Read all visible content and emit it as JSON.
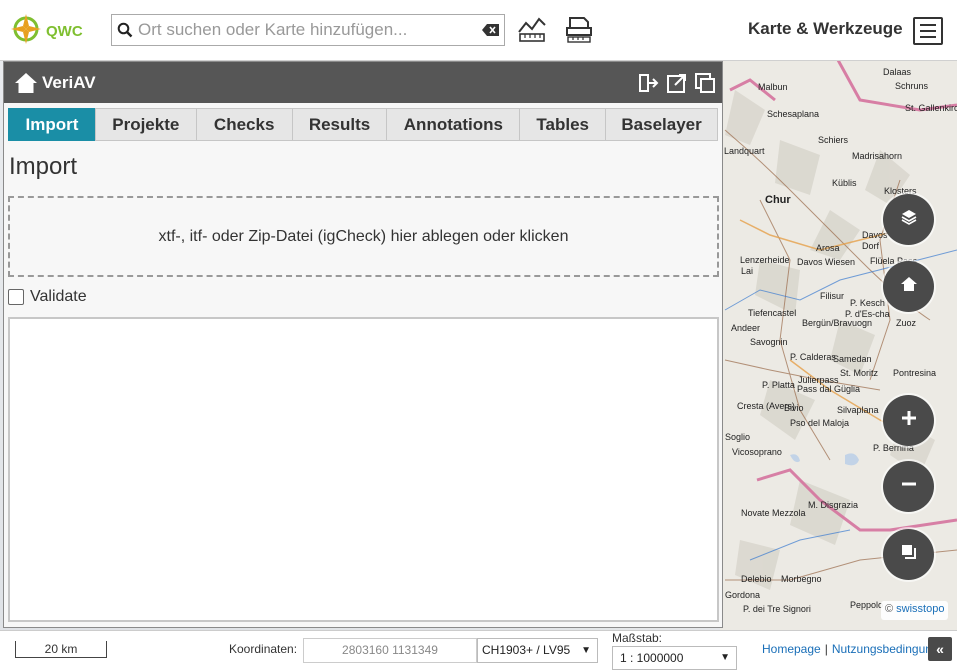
{
  "topbar": {
    "logo_text": "QWC",
    "search_placeholder": "Ort suchen oder Karte hinzufügen...",
    "menu_title": "Karte & Werkzeuge"
  },
  "panel": {
    "title": "VeriAV",
    "tabs": [
      {
        "label": "Import",
        "active": true
      },
      {
        "label": "Projekte",
        "active": false
      },
      {
        "label": "Checks",
        "active": false
      },
      {
        "label": "Results",
        "active": false
      },
      {
        "label": "Annotations",
        "active": false
      },
      {
        "label": "Tables",
        "active": false
      },
      {
        "label": "Baselayer",
        "active": false
      }
    ],
    "section_title": "Import",
    "dropzone_text": "xtf-, itf- oder Zip-Datei (igCheck) hier ablegen oder klicken",
    "validate_label": "Validate",
    "validate_checked": false
  },
  "map": {
    "places": [
      "Dalaas",
      "Schruns",
      "Malbun",
      "St. Gallenkirch",
      "Schesaplana",
      "Landquart",
      "Schiers",
      "Madrisahorn",
      "Küblis",
      "Klosters",
      "Chur",
      "Davos",
      "Arosa",
      "Dorf",
      "Lenzerheide",
      "Lai",
      "Davos Wiesen",
      "Flüela Pass",
      "Filisur",
      "P. Kesch",
      "P. d'Es-cha",
      "Zuoz",
      "Tiefencastel",
      "Bergün/Bravuogn",
      "Andeer",
      "Savognin",
      "P. Calderas",
      "Samedan",
      "St. Moritz",
      "Pontresina",
      "Julierpass",
      "Pass dal Güglia",
      "P. Platta",
      "Cresta (Avers)",
      "Bivio",
      "Silvaplana",
      "Pso del Maloja",
      "P. Bernina",
      "Soglio",
      "Vicosoprano",
      "M. Disgrazia",
      "Novate Mezzola",
      "Delebio",
      "Morbegno",
      "Gordona",
      "P. dei Tre Signori",
      "Peppolo"
    ],
    "attribution_prefix": "©",
    "attribution_link": "swisstopo"
  },
  "bottombar": {
    "scale_text": "20 km",
    "coord_label": "Koordinaten:",
    "coord_value": "2803160 1131349",
    "crs": "CH1903+ / LV95",
    "scale_label": "Maßstab:",
    "scale_value": "1 :  1000000",
    "link_homepage": "Homepage",
    "link_separator": "|",
    "link_terms": "Nutzungsbedingungen",
    "collapse_glyph": "«"
  },
  "colors": {
    "accent": "#1a8ea6",
    "panel_header": "#565656",
    "map_button": "#4a4a4a",
    "logo_green": "#7fbf30",
    "link_blue": "#1a6fb8"
  },
  "icons": [
    "compass-logo-icon",
    "search-icon",
    "clear-input-icon",
    "measure-icon",
    "print-icon",
    "hamburger-icon",
    "home-icon",
    "dock-icon",
    "detach-icon",
    "minimize-icon",
    "layers-icon",
    "home-view-icon",
    "zoom-in-icon",
    "zoom-out-icon",
    "background-map-icon",
    "collapse-icon"
  ]
}
